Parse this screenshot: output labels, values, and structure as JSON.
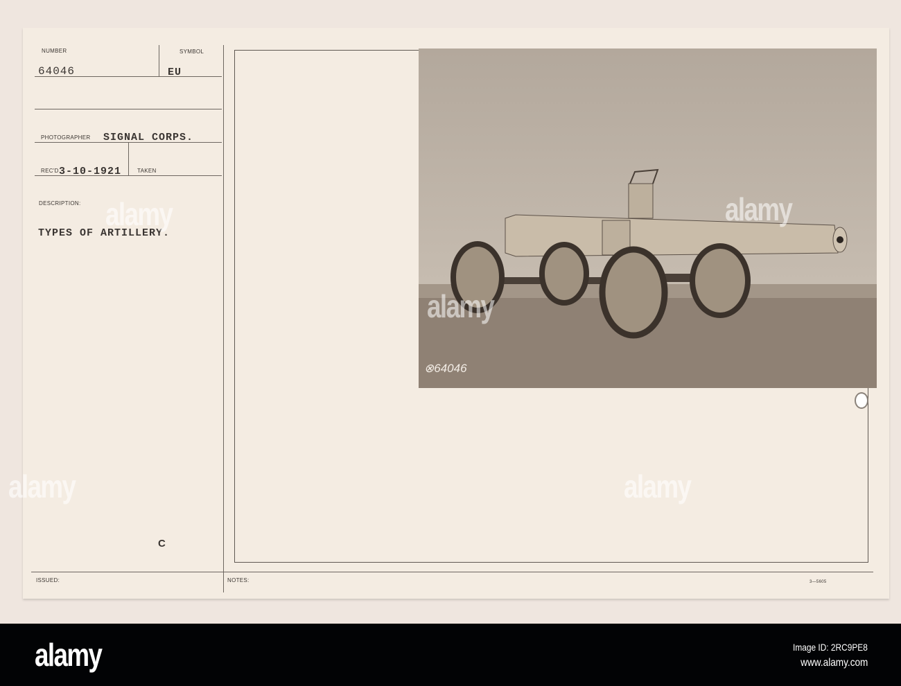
{
  "record": {
    "number_label": "NUMBER",
    "number": "64046",
    "symbol_label": "SYMBOL",
    "symbol": "EU",
    "photographer_label": "PHOTOGRAPHER",
    "photographer": "SIGNAL CORPS.",
    "recd_label": "REC'D",
    "recd_date": "3-10-1921",
    "taken_label": "TAKEN",
    "description_label": "DESCRIPTION:",
    "description": "TYPES OF ARTILLERY.",
    "mark": "C",
    "issued_label": "ISSUED:",
    "notes_label": "NOTES:",
    "form_number": "3—5605"
  },
  "photo": {
    "negative_number": "⊗64046"
  },
  "watermark": "alamy",
  "footer": {
    "logo": "alamy",
    "image_id": "Image ID: 2RC9PE8",
    "url": "www.alamy.com"
  }
}
